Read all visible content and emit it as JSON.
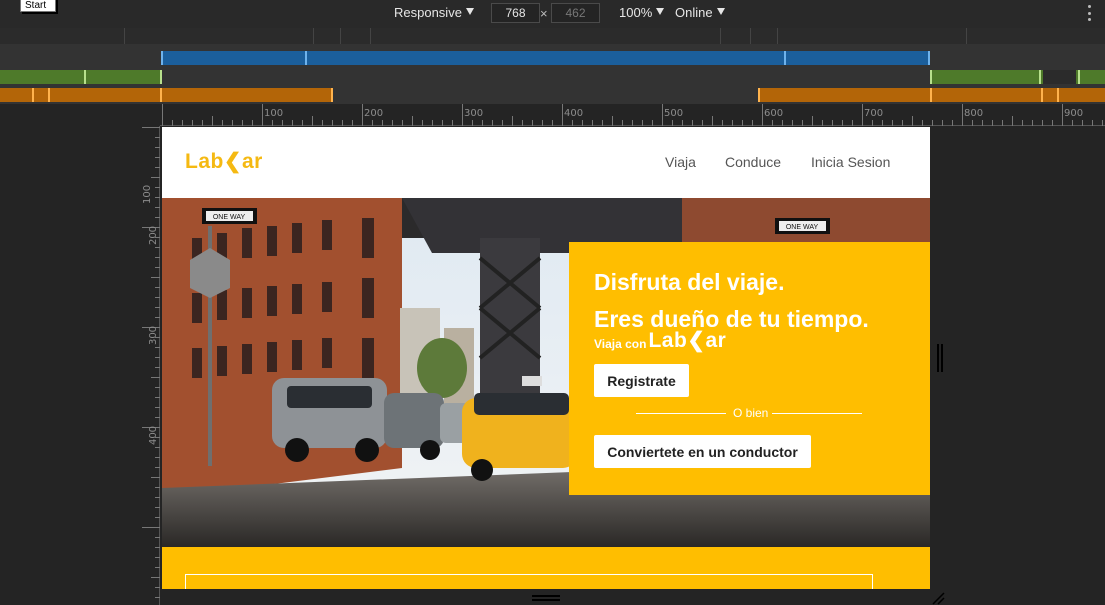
{
  "tooltip": {
    "start": "Start"
  },
  "toolbar": {
    "device": "Responsive",
    "width": "768",
    "times": "×",
    "height": "462",
    "zoom": "100%",
    "network": "Online"
  },
  "ruler_top": [
    "100",
    "200",
    "300",
    "400",
    "500",
    "600",
    "700",
    "800",
    "900"
  ],
  "ruler_left": [
    "100",
    "200",
    "300",
    "400"
  ],
  "site": {
    "logo_left": "Lab",
    "logo_right": "ar",
    "nav": [
      "Viaja",
      "Conduce",
      "Inicia Sesion"
    ]
  },
  "hero": {
    "heading_1": "Disfruta del viaje.",
    "heading_2": "Eres dueño de tu tiempo.",
    "viaja_con": "Viaja con",
    "logo_left": "Lab",
    "logo_right": "ar",
    "btn_registrate": "Registrate",
    "divider": "O bien",
    "btn_conductor": "Conviertete en un conductor",
    "sign_one_way": "ONE WAY"
  },
  "colors": {
    "brand_yellow": "#ffbe00",
    "logo_yellow": "#f5b912",
    "devtools_bg": "#242424",
    "mq_blue": "#1b5f9c",
    "mq_green": "#4e7a2a",
    "mq_orange": "#b36508"
  }
}
